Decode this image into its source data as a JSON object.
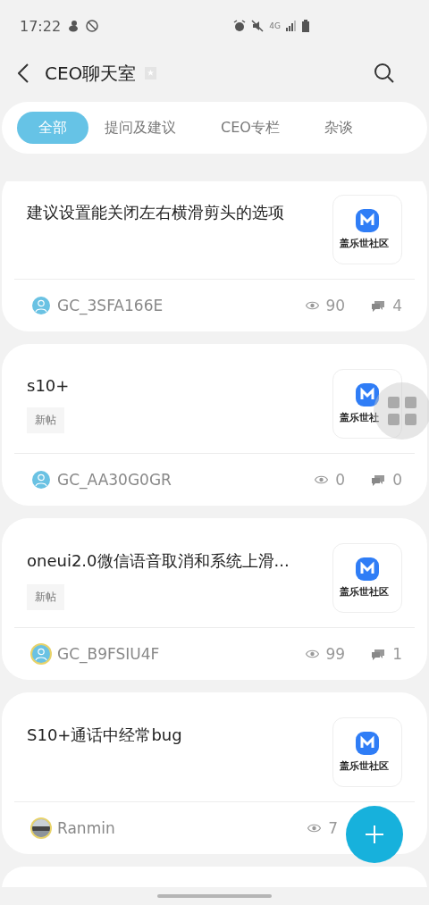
{
  "status_bar": {
    "time": "17:22",
    "network": "4G"
  },
  "header": {
    "title": "CEO聊天室"
  },
  "tabs": [
    {
      "label": "全部",
      "selected": true
    },
    {
      "label": "提问及建议",
      "selected": false
    },
    {
      "label": "CEO专栏",
      "selected": false
    },
    {
      "label": "杂谈",
      "selected": false
    }
  ],
  "posts": [
    {
      "title": "建议设置能关闭左右横滑剪头的选项",
      "thumbnail_caption": "盖乐世社区",
      "author": "GC_3SFA166E",
      "avatar": {
        "kind": "default",
        "ring": false
      },
      "views": "90",
      "comments": "4"
    },
    {
      "title": "s10+",
      "tag": "新帖",
      "thumbnail_caption": "盖乐世社",
      "author": "GC_AA30G0GR",
      "avatar": {
        "kind": "default",
        "ring": false
      },
      "views": "0",
      "comments": "0"
    },
    {
      "title": "oneui2.0微信语音取消和系统上滑...",
      "tag": "新帖",
      "thumbnail_caption": "盖乐世社区",
      "author": "GC_B9FSIU4F",
      "avatar": {
        "kind": "default",
        "ring": true
      },
      "views": "99",
      "comments": "1"
    },
    {
      "title": "S10+通话中经常bug",
      "thumbnail_caption": "盖乐世社区",
      "author": "Ranmin",
      "avatar": {
        "kind": "picture",
        "ring": true
      },
      "views": "7"
    }
  ]
}
